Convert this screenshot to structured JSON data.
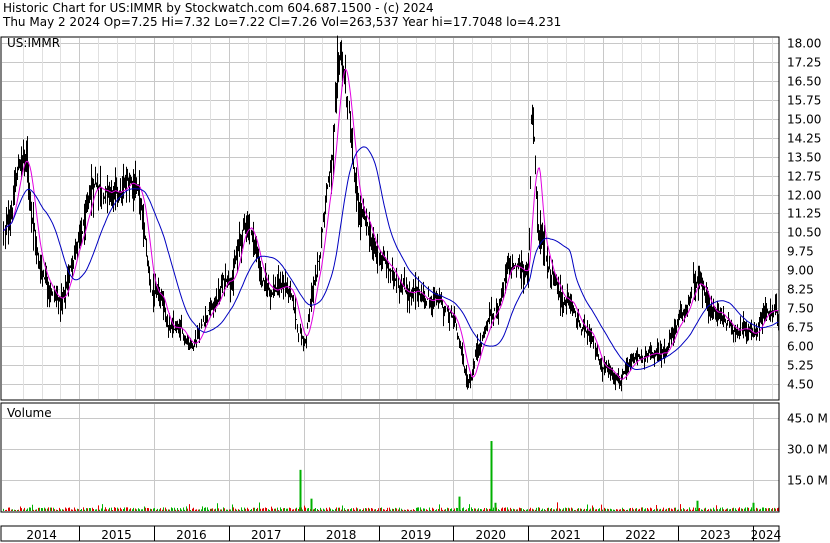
{
  "header": {
    "line1": "Historic Chart for US:IMMR by Stockwatch.com 604.687.1500 - (c) 2024",
    "line2": "Thu May  2 2024   Op=7.25  Hi=7.32  Lo=7.22  Cl=7.26  Vol=263,537  Year hi=17.7048  lo=4.231"
  },
  "colors": {
    "price": "#000000",
    "ma_short": "#e000e0",
    "ma_long": "#0000c0",
    "grid": "#c8c8c8",
    "volume_up": "#00b000",
    "volume_down": "#e00000"
  },
  "chart_data": [
    {
      "type": "line",
      "title": "US:IMMR",
      "ylim": [
        3.9,
        18.2
      ],
      "y_ticks": [
        "18.00",
        "17.25",
        "16.50",
        "15.75",
        "15.00",
        "14.25",
        "13.50",
        "12.75",
        "12.00",
        "11.25",
        "10.50",
        "9.75",
        "9.00",
        "8.25",
        "7.50",
        "6.75",
        "6.00",
        "5.25",
        "4.50"
      ],
      "x": [
        "2014.0",
        "2014.25",
        "2014.5",
        "2014.75",
        "2015.0",
        "2015.25",
        "2015.5",
        "2015.75",
        "2016.0",
        "2016.25",
        "2016.5",
        "2016.75",
        "2017.0",
        "2017.25",
        "2017.5",
        "2017.75",
        "2018.0",
        "2018.15",
        "2018.35",
        "2018.5",
        "2018.75",
        "2019.0",
        "2019.25",
        "2019.5",
        "2019.75",
        "2020.0",
        "2020.2",
        "2020.35",
        "2020.5",
        "2020.75",
        "2021.0",
        "2021.05",
        "2021.15",
        "2021.3",
        "2021.5",
        "2021.75",
        "2022.0",
        "2022.25",
        "2022.5",
        "2022.75",
        "2023.0",
        "2023.25",
        "2023.5",
        "2023.75",
        "2024.0",
        "2024.15",
        "2024.33"
      ],
      "series": [
        {
          "values": [
            10.5,
            13.5,
            9.0,
            7.8,
            10.2,
            12.5,
            11.8,
            12.6,
            8.0,
            6.6,
            6.2,
            7.5,
            8.8,
            10.8,
            8.3,
            8.4,
            6.2,
            8.5,
            13.0,
            17.0,
            11.0,
            9.5,
            8.6,
            8.0,
            7.8,
            7.0,
            4.6,
            6.2,
            7.2,
            9.0,
            9.0,
            15.5,
            10.5,
            9.0,
            7.8,
            6.5,
            5.2,
            4.8,
            5.5,
            5.6,
            6.8,
            8.4,
            7.3,
            6.8,
            6.6,
            7.3,
            7.26
          ]
        }
      ],
      "x_tick_labels": [
        "2014",
        "2015",
        "2016",
        "2017",
        "2018",
        "2019",
        "2020",
        "2021",
        "2022",
        "2023",
        "2024"
      ]
    },
    {
      "type": "bar",
      "title": "Volume",
      "ylim": [
        0,
        52
      ],
      "y_ticks": [
        "45.0 M",
        "30.0 M",
        "15.0 M"
      ],
      "spikes": [
        {
          "x": "2017.95",
          "value": 20
        },
        {
          "x": "2018.1",
          "value": 6
        },
        {
          "x": "2020.08",
          "value": 7
        },
        {
          "x": "2020.5",
          "value": 34
        },
        {
          "x": "2020.55",
          "value": 4
        },
        {
          "x": "2023.25",
          "value": 5
        },
        {
          "x": "2024.0",
          "value": 4
        }
      ]
    }
  ]
}
